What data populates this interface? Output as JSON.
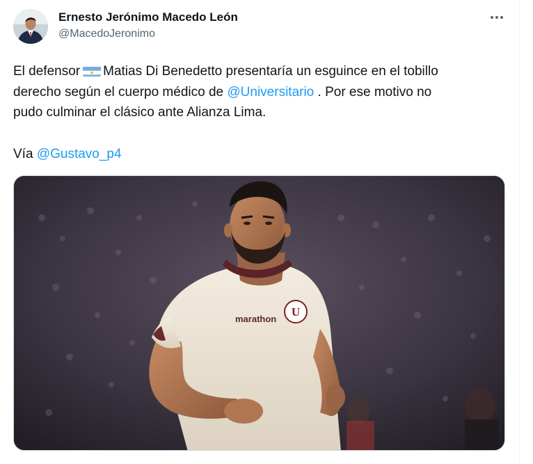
{
  "author": {
    "name": "Ernesto Jerónimo Macedo León",
    "handle": "@MacedoJeronimo"
  },
  "tweet": {
    "line1_a": "El defensor",
    "line1_b": "Matias Di Benedetto presentaría un esguince en el tobillo",
    "line2_a": "derecho según el cuerpo médico de",
    "mention1": "@Universitario",
    "line2_b": ". Por ese motivo no",
    "line3": "pudo culminar el clásico ante Alianza Lima.",
    "via_label": "Vía",
    "mention2": "@Gustavo_p4"
  },
  "media": {
    "jersey_sponsor": "marathon",
    "crest_letter": "U"
  },
  "icons": {
    "more": "more-horizontal-icon",
    "flag": "argentina-flag-icon"
  },
  "colors": {
    "link": "#1d9bf0",
    "text": "#0f1419",
    "secondary": "#536471"
  }
}
